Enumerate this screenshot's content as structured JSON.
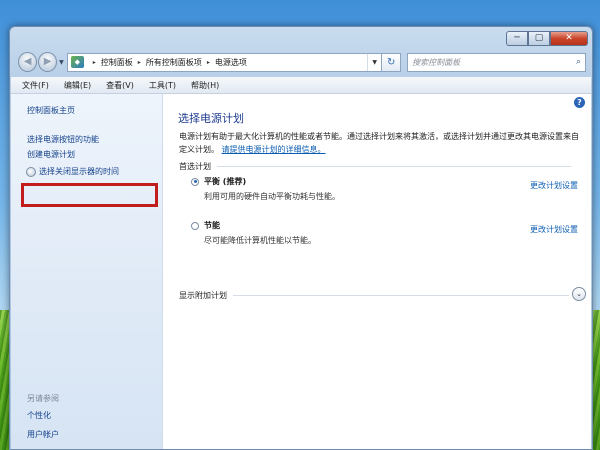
{
  "window": {
    "minimize_label": "─",
    "maximize_label": "▢",
    "close_label": "✕"
  },
  "navigation": {
    "back_label": "◀",
    "forward_label": "▶",
    "dropdown_label": "▼",
    "breadcrumbs": [
      "控制面板",
      "所有控制面板项",
      "电源选项"
    ],
    "crumb_separator": "▸",
    "refresh_label": "↻",
    "search_placeholder": "搜索控制面板",
    "search_icon": "⌕"
  },
  "menubar": {
    "items": [
      "文件(F)",
      "编辑(E)",
      "查看(V)",
      "工具(T)",
      "帮助(H)"
    ]
  },
  "sidebar": {
    "home": "控制面板主页",
    "links": [
      "选择电源按钮的功能",
      "创建电源计划",
      "选择关闭显示器的时间"
    ],
    "see_also_title": "另请参阅",
    "see_also_links": [
      "个性化",
      "用户帐户"
    ]
  },
  "content": {
    "help_label": "?",
    "title": "选择电源计划",
    "description": "电源计划有助于最大化计算机的性能或者节能。通过选择计划来将其激活，或选择计划并通过更改其电源设置来自定义计划。",
    "description_link": "请提供电源计划的详细信息。",
    "preferred_section": "首选计划",
    "plans": [
      {
        "name": "平衡 (推荐)",
        "description": "利用可用的硬件自动平衡功耗与性能。",
        "link": "更改计划设置",
        "selected": true
      },
      {
        "name": "节能",
        "description": "尽可能降低计算机性能以节能。",
        "link": "更改计划设置",
        "selected": false
      }
    ],
    "additional_section": "显示附加计划",
    "expand_label": "⌄"
  }
}
